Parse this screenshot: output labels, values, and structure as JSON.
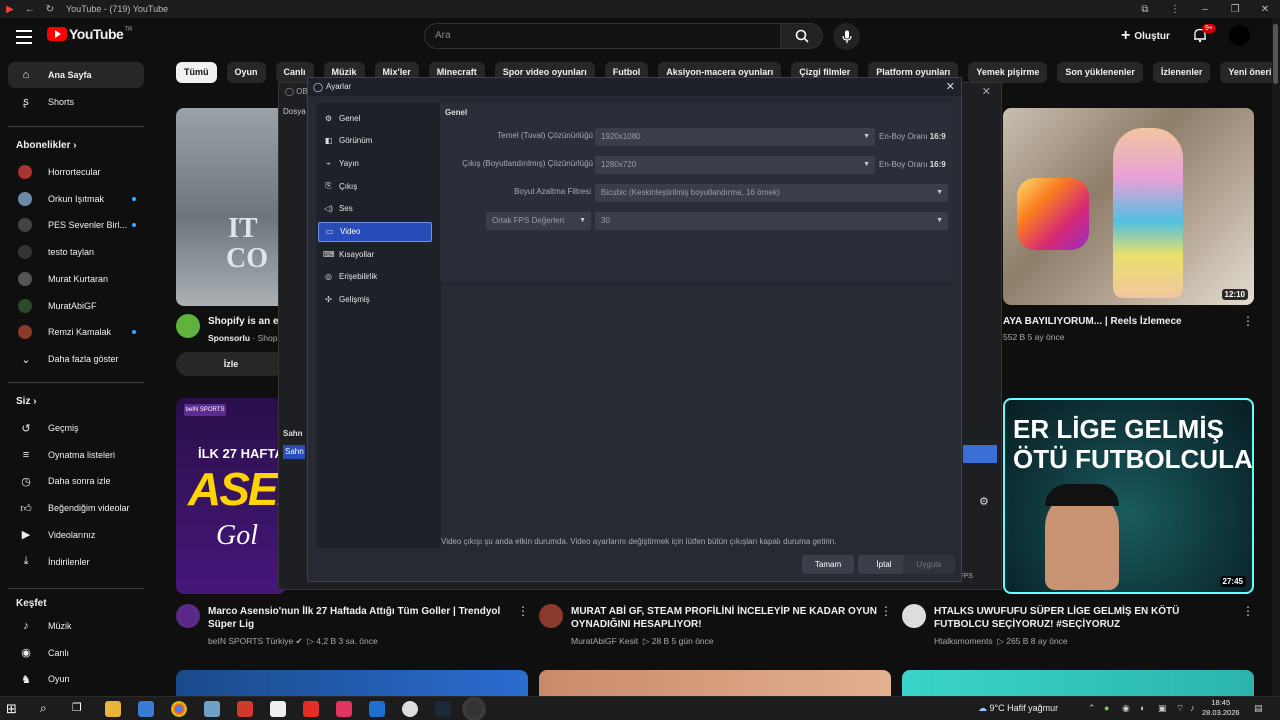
{
  "browser": {
    "title": "YouTube - (719) YouTube"
  },
  "youtube": {
    "logo_text": "YouTube",
    "logo_region": "TR",
    "search_placeholder": "Ara",
    "create_label": "Oluştur",
    "notif_badge": "9+",
    "chips": [
      "Tümü",
      "Oyun",
      "Canlı",
      "Müzik",
      "Mix'ler",
      "Minecraft",
      "Spor video oyunları",
      "Futbol",
      "Aksiyon-macera oyunları",
      "Çizgi filmler",
      "Platform oyunları",
      "Yemek pişirme",
      "Son yüklenenler",
      "İzlenenler",
      "Yeni öneriler"
    ]
  },
  "sidebar": {
    "main": [
      {
        "label": "Ana Sayfa",
        "icon": "home-icon"
      },
      {
        "label": "Shorts",
        "icon": "shorts-icon"
      }
    ],
    "subs_header": "Abonelikler",
    "subs": [
      {
        "label": "Horrortecular",
        "color": "#a33",
        "dot": false
      },
      {
        "label": "Orkun Işıtmak",
        "color": "#6a8ba8",
        "dot": true
      },
      {
        "label": "PES Sevenler Birl...",
        "color": "#444",
        "dot": true
      },
      {
        "label": "testo taylan",
        "color": "#333",
        "dot": false
      },
      {
        "label": "Murat Kurtaran",
        "color": "#555",
        "dot": false
      },
      {
        "label": "MuratAbiGF",
        "color": "#2a4a2a",
        "dot": false
      },
      {
        "label": "Remzi Kamalak",
        "color": "#8a3b2b",
        "dot": true
      }
    ],
    "show_more": "Daha fazla göster",
    "you_header": "Siz",
    "you": [
      {
        "label": "Geçmiş",
        "icon": "history-icon"
      },
      {
        "label": "Oynatma listeleri",
        "icon": "playlists-icon"
      },
      {
        "label": "Daha sonra izle",
        "icon": "watch-later-icon"
      },
      {
        "label": "Beğendiğim videolar",
        "icon": "liked-icon"
      },
      {
        "label": "Videolarınız",
        "icon": "your-videos-icon"
      },
      {
        "label": "İndirilenler",
        "icon": "downloads-icon"
      }
    ],
    "explore_header": "Keşfet",
    "explore": [
      {
        "label": "Müzik",
        "icon": "music-icon"
      },
      {
        "label": "Canlı",
        "icon": "live-icon"
      },
      {
        "label": "Oyun",
        "icon": "gaming-icon"
      }
    ]
  },
  "videos": {
    "ad": {
      "title": "Shopify is an e",
      "sponsor": "Sponsorlu",
      "sponsor_tail": " · Shop",
      "cta": "İzle"
    },
    "reels": {
      "title": "AYA BAYILIYORUM... | Reels İzlemece",
      "meta": "552 B   5 ay önce",
      "duration": "12:10"
    },
    "asensio": {
      "title": "Marco Asensio'nun İlk 27 Haftada Attığı Tüm Goller | Trendyol Süper Lig",
      "channel": "beIN SPORTS Türkiye ✔",
      "meta": "▷ 4,2 B   3 sa. önce",
      "thumb_top": "İLK 27 HAFTA",
      "thumb_big": "ASEN",
      "thumb_sub": "Gol"
    },
    "murat": {
      "title": "MURAT ABİ GF, STEAM PROFİLİNİ İNCELEYİP NE KADAR OYUN OYNADIĞINI HESAPLIYOR!",
      "channel": "MuratAbiGF Kesit",
      "meta": "▷ 28 B   5 gün önce"
    },
    "htalks": {
      "title": "HTALKS UWUFUFU  SÜPER LİGE GELMİŞ EN KÖTÜ FUTBOLCU SEÇİYORUZ! #SEÇİYORUZ",
      "channel": "Htalksmoments",
      "meta": "▷ 265 B   8 ay önce",
      "thumb_line1": "ER LİGE GELMİŞ",
      "thumb_line2": "ÖTÜ FUTBOLCULAR",
      "duration": "27:45"
    }
  },
  "obs": {
    "dialog_title": "Ayarlar",
    "nav": [
      {
        "label": "Genel",
        "icon": "gear-icon"
      },
      {
        "label": "Görünüm",
        "icon": "appearance-icon"
      },
      {
        "label": "Yayın",
        "icon": "stream-icon"
      },
      {
        "label": "Çıkış",
        "icon": "output-icon"
      },
      {
        "label": "Ses",
        "icon": "audio-icon"
      },
      {
        "label": "Video",
        "icon": "video-icon",
        "active": true
      },
      {
        "label": "Kısayollar",
        "icon": "hotkeys-icon"
      },
      {
        "label": "Erişebilirlik",
        "icon": "accessibility-icon"
      },
      {
        "label": "Gelişmiş",
        "icon": "advanced-icon"
      }
    ],
    "section": "Genel",
    "fields": {
      "base_label": "Temel (Tuval) Çözünürlüğü",
      "base_value": "1920x1080",
      "output_label": "Çıkış (Boyutlandırılmış) Çözünürlüğü",
      "output_value": "1280x720",
      "aspect_label": "En-Boy Oranı",
      "aspect_value": "16:9",
      "filter_label": "Boyut Azaltma Filtresi",
      "filter_value": "Bicubic (Keskinleştirilmiş boyutlandırma, 16 örnek)",
      "fps_label": "Ortak FPS Değerleri",
      "fps_value": "30"
    },
    "warning": "Video çıkışı şu anda etkin durumda. Video ayarlarını değiştirmek için lütfen bütün çıkışları kapalı duruma getirin.",
    "buttons": {
      "ok": "Tamam",
      "cancel": "İptal",
      "apply": "Uygula"
    },
    "bg_menu": "Dosya",
    "bg_scene": "Sahn",
    "fps_tag": ") FPS"
  },
  "taskbar": {
    "weather": "9°C  Hafif yağmur",
    "time": "18:45",
    "date": "28.03.2026"
  }
}
